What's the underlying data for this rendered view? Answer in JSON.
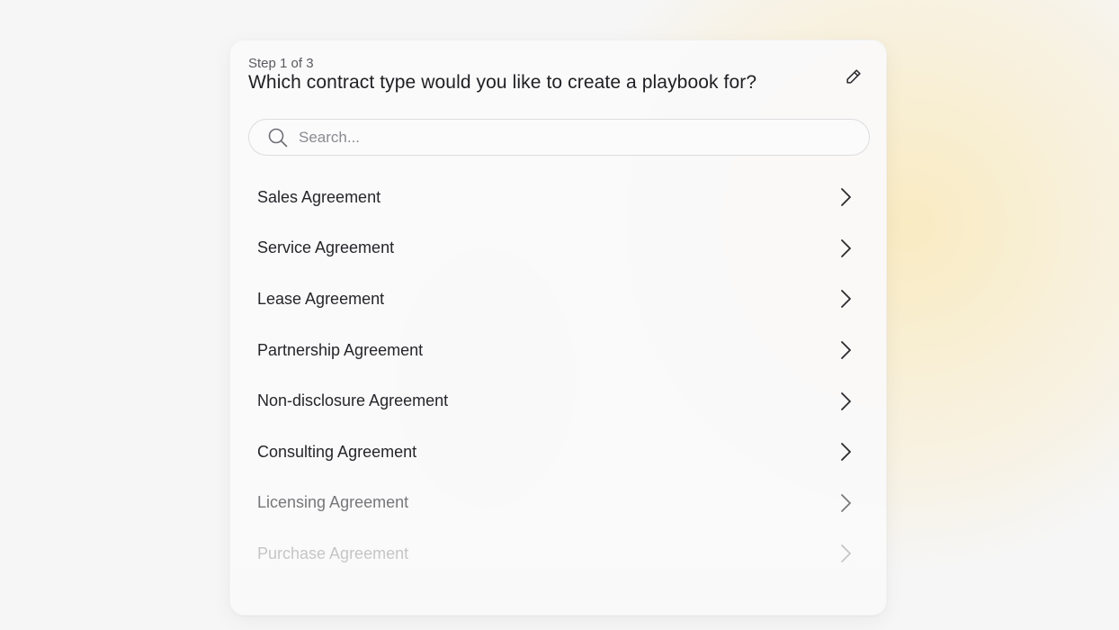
{
  "header": {
    "step_label": "Step 1 of 3",
    "title": "Which contract type would you like to create a playbook for?",
    "edit_icon": "pencil-icon"
  },
  "search": {
    "placeholder": "Search...",
    "value": "",
    "icon": "search-icon"
  },
  "contract_types": [
    {
      "label": "Sales Agreement"
    },
    {
      "label": "Service Agreement"
    },
    {
      "label": "Lease Agreement"
    },
    {
      "label": "Partnership Agreement"
    },
    {
      "label": "Non-disclosure Agreement"
    },
    {
      "label": "Consulting Agreement"
    },
    {
      "label": "Licensing Agreement"
    },
    {
      "label": "Purchase Agreement"
    }
  ],
  "colors": {
    "accent_glow": "#fce296",
    "text_primary": "#1f1f23",
    "text_secondary": "#5a5a5f"
  }
}
